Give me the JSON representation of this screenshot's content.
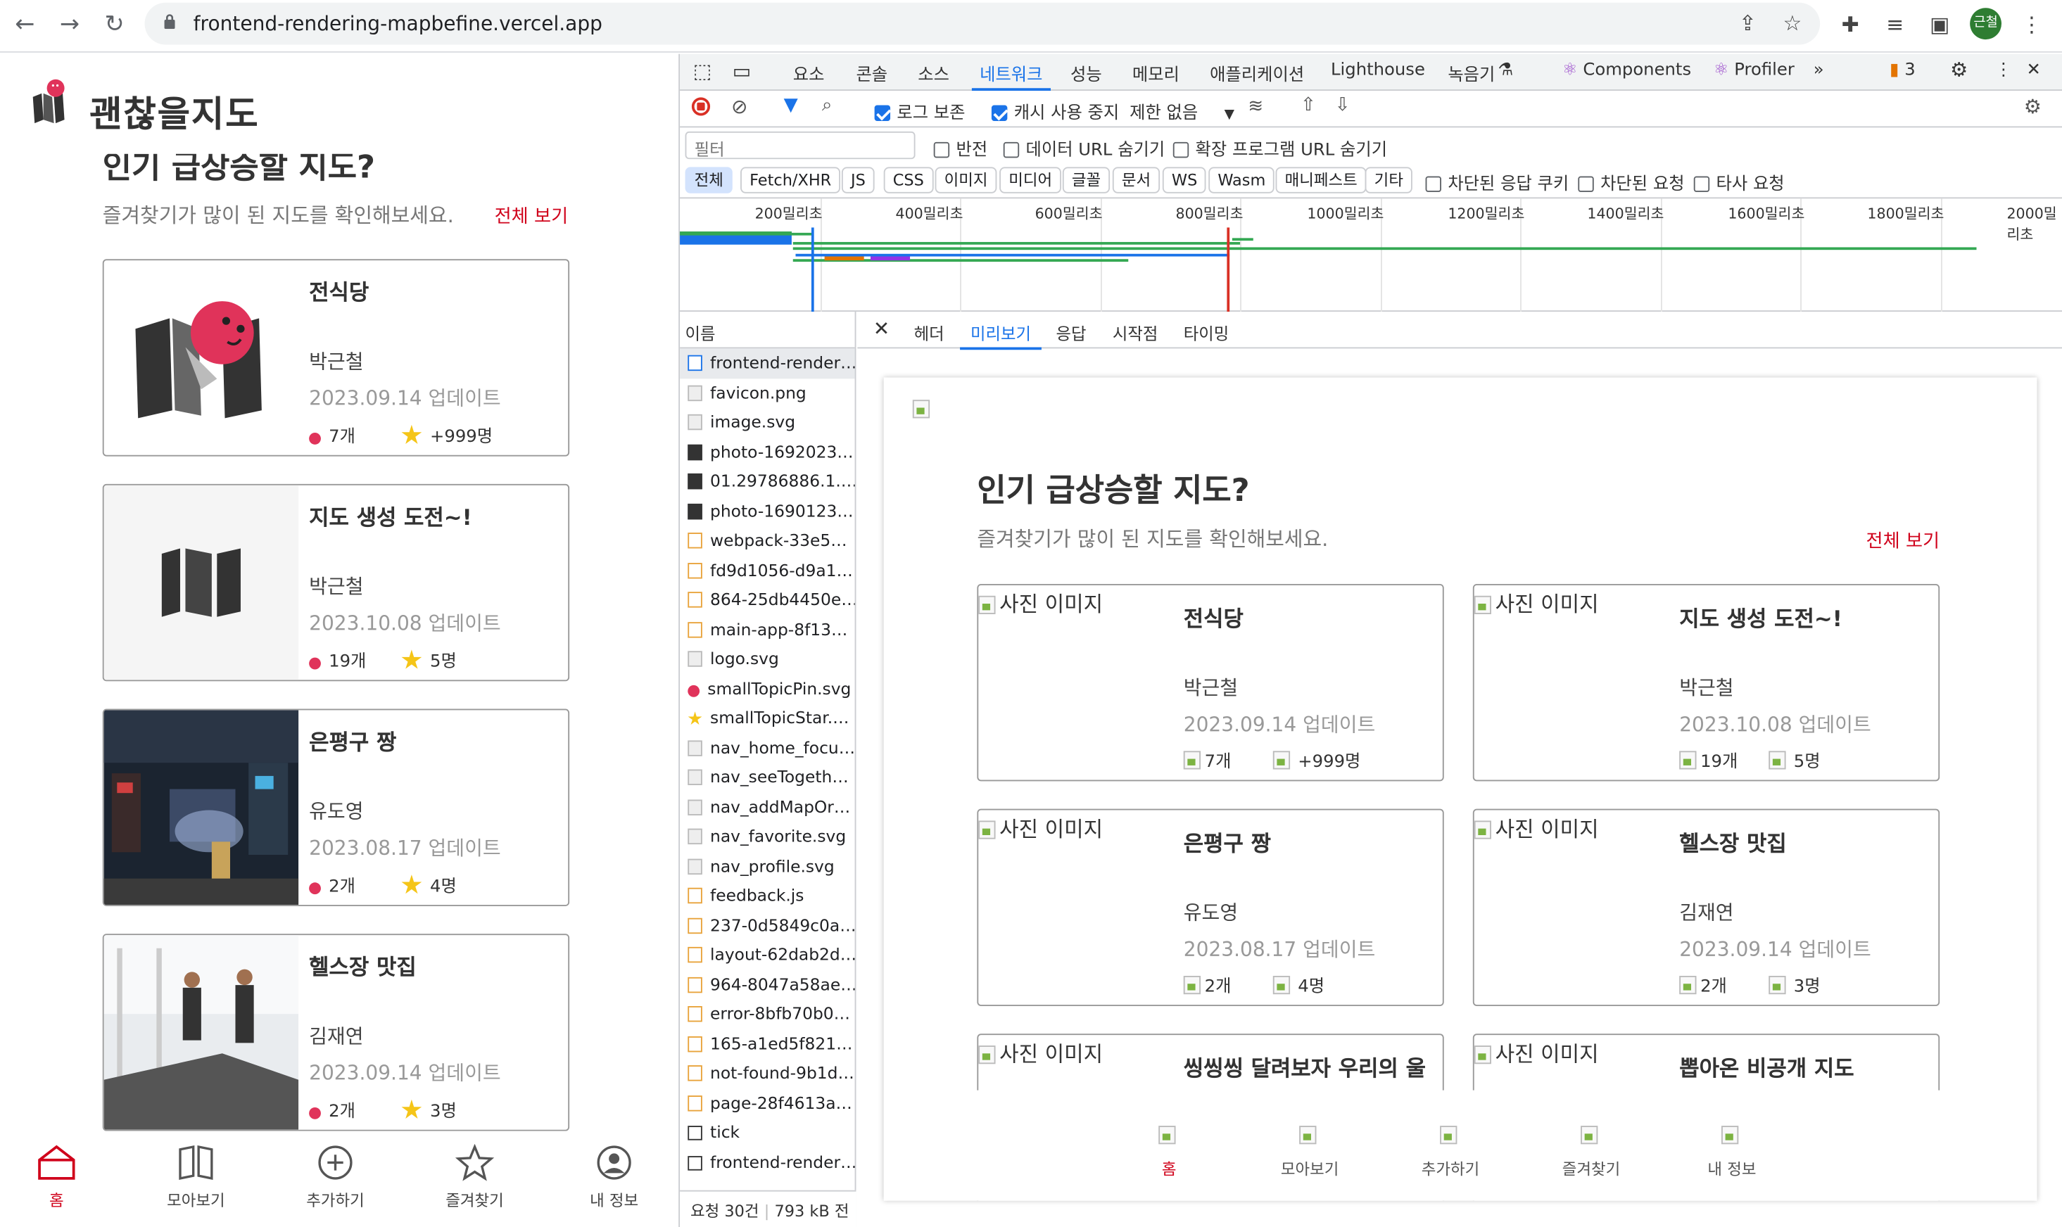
{
  "browser": {
    "url": "frontend-rendering-mapbefine.vercel.app",
    "profile_initials": "근철"
  },
  "app": {
    "logo_text": "괜찮을지도",
    "section_title": "인기 급상승할 지도?",
    "section_subtitle": "즐겨찾기가 많이 된 지도를 확인해보세요.",
    "see_all": "전체 보기",
    "cards": [
      {
        "title": "전식당",
        "author": "박근철",
        "date": "2023.09.14 업데이트",
        "pins": "7개",
        "stars": "+999명",
        "thumb": "logo-pin"
      },
      {
        "title": "지도 생성 도전~!",
        "author": "박근철",
        "date": "2023.10.08 업데이트",
        "pins": "19개",
        "stars": "5명",
        "thumb": "map-icon"
      },
      {
        "title": "은평구 짱",
        "author": "유도영",
        "date": "2023.08.17 업데이트",
        "pins": "2개",
        "stars": "4명",
        "thumb": "night-street-photo"
      },
      {
        "title": "헬스장 맛집",
        "author": "김재연",
        "date": "2023.09.14 업데이트",
        "pins": "2개",
        "stars": "3명",
        "thumb": "gym-photo"
      }
    ],
    "nav": [
      {
        "label": "홈",
        "icon": "home-icon",
        "active": true
      },
      {
        "label": "모아보기",
        "icon": "book-icon",
        "active": false
      },
      {
        "label": "추가하기",
        "icon": "plus-circle-icon",
        "active": false
      },
      {
        "label": "즐겨찾기",
        "icon": "star-icon",
        "active": false
      },
      {
        "label": "내 정보",
        "icon": "profile-icon",
        "active": false
      }
    ]
  },
  "devtools": {
    "tabs": [
      "요소",
      "콘솔",
      "소스",
      "네트워크",
      "성능",
      "메모리",
      "애플리케이션",
      "Lighthouse",
      "녹음기",
      "Components",
      "Profiler"
    ],
    "active_tab": "네트워크",
    "issues_count": "3",
    "toolbar": {
      "preserve_log": "로그 보존",
      "disable_cache": "캐시 사용 중지",
      "throttle": "제한 없음"
    },
    "filter": {
      "placeholder": "필터",
      "invert": "반전",
      "hide_data_urls": "데이터 URL 숨기기",
      "hide_ext_urls": "확장 프로그램 URL 숨기기"
    },
    "types": [
      "전체",
      "Fetch/XHR",
      "JS",
      "CSS",
      "이미지",
      "미디어",
      "글꼴",
      "문서",
      "WS",
      "Wasm",
      "매니페스트",
      "기타"
    ],
    "type_options": {
      "blocked_cookies": "차단된 응답 쿠키",
      "blocked_requests": "차단된 요청",
      "third_party": "타사 요청"
    },
    "timeline_labels": [
      "200밀리초",
      "400밀리초",
      "600밀리초",
      "800밀리초",
      "1000밀리초",
      "1200밀리초",
      "1400밀리초",
      "1600밀리초",
      "1800밀리초",
      "2000밀리초"
    ],
    "name_header": "이름",
    "requests": [
      {
        "name": "frontend-render…",
        "type": "doc"
      },
      {
        "name": "favicon.png",
        "type": "img"
      },
      {
        "name": "image.svg",
        "type": "img"
      },
      {
        "name": "photo-1692023…",
        "type": "photo"
      },
      {
        "name": "01.29786886.1.…",
        "type": "photo"
      },
      {
        "name": "photo-1690123…",
        "type": "photo"
      },
      {
        "name": "webpack-33e5…",
        "type": "js"
      },
      {
        "name": "fd9d1056-d9a1…",
        "type": "js"
      },
      {
        "name": "864-25db4450e…",
        "type": "js"
      },
      {
        "name": "main-app-8f13…",
        "type": "js"
      },
      {
        "name": "logo.svg",
        "type": "img"
      },
      {
        "name": "smallTopicPin.svg",
        "type": "pin"
      },
      {
        "name": "smallTopicStar.…",
        "type": "star"
      },
      {
        "name": "nav_home_focu…",
        "type": "img"
      },
      {
        "name": "nav_seeTogeth…",
        "type": "img"
      },
      {
        "name": "nav_addMapOr…",
        "type": "img"
      },
      {
        "name": "nav_favorite.svg",
        "type": "img"
      },
      {
        "name": "nav_profile.svg",
        "type": "img"
      },
      {
        "name": "feedback.js",
        "type": "js"
      },
      {
        "name": "237-0d5849c0a…",
        "type": "js"
      },
      {
        "name": "layout-62dab2d…",
        "type": "js"
      },
      {
        "name": "964-8047a58ae…",
        "type": "js"
      },
      {
        "name": "error-8bfb70b0…",
        "type": "js"
      },
      {
        "name": "165-a1ed5f821…",
        "type": "js"
      },
      {
        "name": "not-found-9b1d…",
        "type": "js"
      },
      {
        "name": "page-28f4613a…",
        "type": "js"
      },
      {
        "name": "tick",
        "type": "tick"
      },
      {
        "name": "frontend-render…",
        "type": "tick"
      }
    ],
    "status": {
      "requests": "요청 30건",
      "size": "793 kB 전"
    },
    "preview_tabs": [
      "헤더",
      "미리보기",
      "응답",
      "시작점",
      "타이밍"
    ],
    "active_preview_tab": "미리보기",
    "preview": {
      "title": "인기 급상승할 지도?",
      "subtitle": "즐겨찾기가 많이 된 지도를 확인해보세요.",
      "see_all": "전체 보기",
      "img_alt": "사진 이미지",
      "cards": [
        {
          "title": "전식당",
          "author": "박근철",
          "date": "2023.09.14 업데이트",
          "pins": "7개",
          "stars": "+999명"
        },
        {
          "title": "지도 생성 도전~!",
          "author": "박근철",
          "date": "2023.10.08 업데이트",
          "pins": "19개",
          "stars": "5명"
        },
        {
          "title": "은평구 짱",
          "author": "유도영",
          "date": "2023.08.17 업데이트",
          "pins": "2개",
          "stars": "4명"
        },
        {
          "title": "헬스장 맛집",
          "author": "김재연",
          "date": "2023.09.14 업데이트",
          "pins": "2개",
          "stars": "3명"
        },
        {
          "title": "씽씽씽 달려보자 우리의 울",
          "author": "",
          "date": "",
          "pins": "",
          "stars": ""
        },
        {
          "title": "뽑아온 비공개 지도",
          "author": "",
          "date": "",
          "pins": "",
          "stars": ""
        }
      ],
      "nav": [
        "홈",
        "모아보기",
        "추가하기",
        "즐겨찾기",
        "내 정보"
      ]
    }
  },
  "colors": {
    "brand_red": "#d0021b",
    "pin_pink": "#e0335a",
    "devtools_blue": "#1a73e8"
  }
}
